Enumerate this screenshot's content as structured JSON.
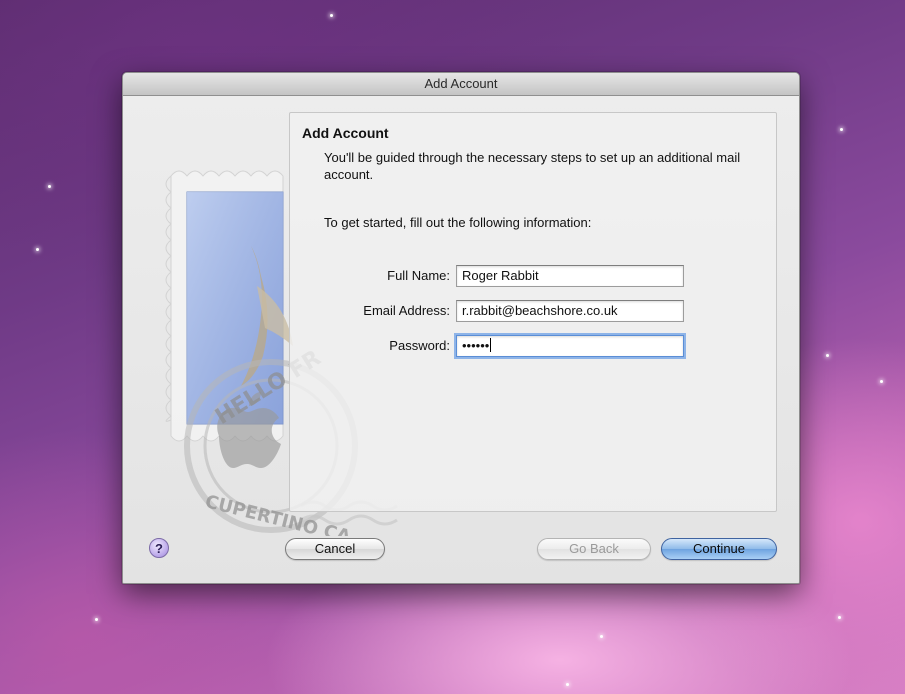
{
  "window": {
    "title": "Add Account"
  },
  "panel": {
    "title": "Add Account",
    "intro": "You'll be guided through the necessary steps to set up an additional mail account.",
    "instruction": "To get started, fill out the following information:"
  },
  "form": {
    "full_name": {
      "label": "Full Name:",
      "value": "Roger Rabbit"
    },
    "email": {
      "label": "Email Address:",
      "value": "r.rabbit@beachshore.co.uk"
    },
    "password": {
      "label": "Password:",
      "value": "••••••"
    }
  },
  "buttons": {
    "help": "?",
    "cancel": "Cancel",
    "go_back": "Go Back",
    "continue": "Continue"
  },
  "stamp": {
    "top_text": "HELLO FR",
    "bottom_text": "CUPERTINO CA"
  },
  "colors": {
    "default_button": "#6ea3e0",
    "focus_ring": "#5b8ed6",
    "help_button": "#b8a4e8"
  }
}
